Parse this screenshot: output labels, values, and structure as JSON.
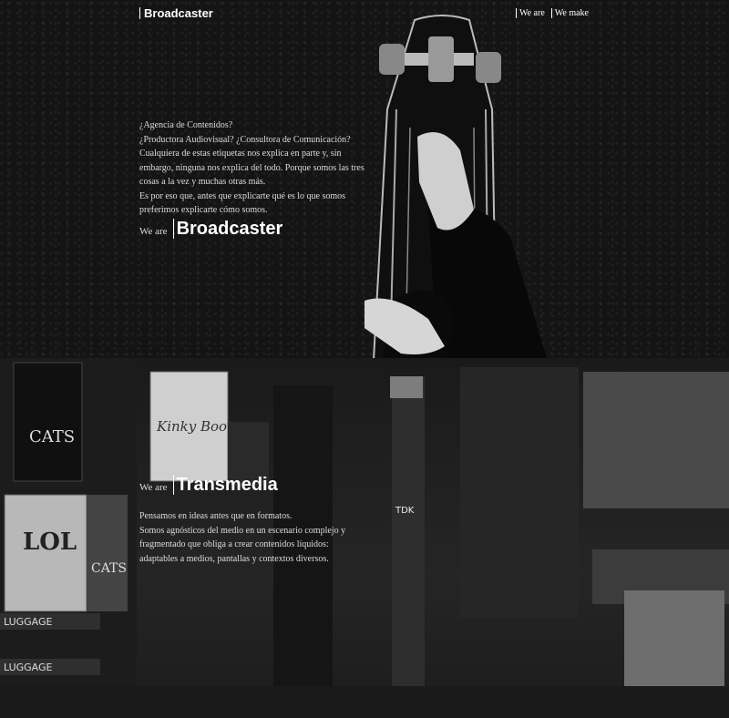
{
  "header": {
    "logo": "Broadcaster",
    "nav": [
      "We are",
      "We make"
    ]
  },
  "hero": {
    "intro": [
      "¿Agencia de Contenidos?",
      "¿Productora Audiovisual? ¿Consultora de Comunicación?",
      "Cualquiera de estas etiquetas nos explica en parte y, sin embargo, ninguna nos explica del todo. Porque somos las tres cosas a la vez y muchas otras más.",
      "Es por eso que, antes que explicarte qué es lo que somos preferimos explicarte cómo somos."
    ],
    "we_are_label": "We are",
    "brand_label": "Broadcaster"
  },
  "city": {
    "we_are_label": "We are",
    "title": "Transmedia",
    "text": [
      "Pensamos en ideas antes que en formatos.",
      "Somos agnósticos del medio en un escenario complejo y fragmentado que obliga a crear contenidos líquidos: adaptables a medios, pantallas y contextos diversos."
    ],
    "signs": [
      "CATS",
      "Kinky Boots",
      "LOL",
      "CATS",
      "TDK",
      "LUGGAGE",
      "LUGGAGE"
    ]
  }
}
